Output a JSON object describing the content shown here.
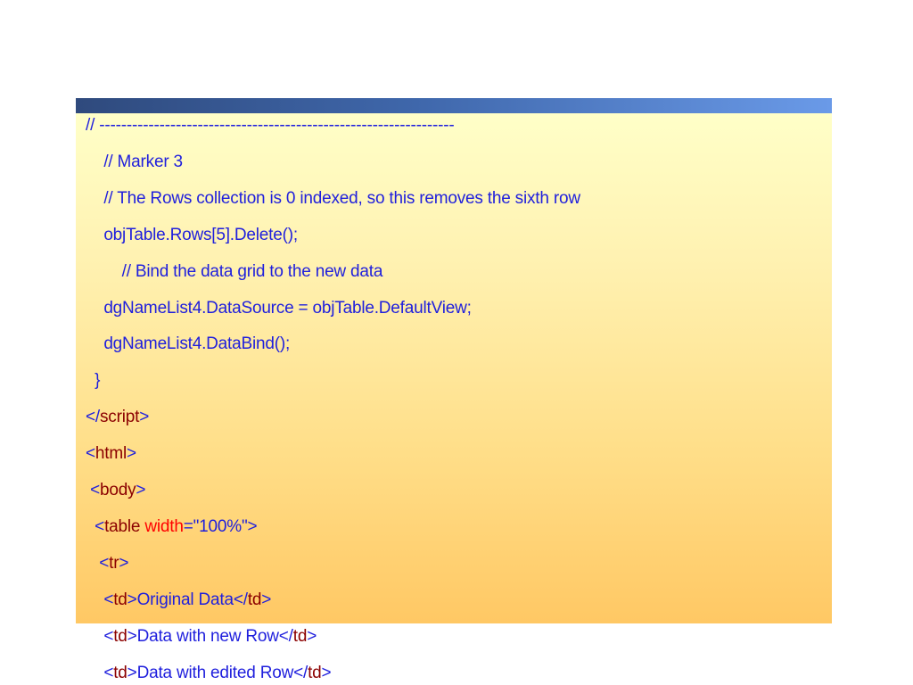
{
  "slide": {
    "code_lines": [
      [
        {
          "text": "// -----------------------------------------------------------------",
          "c": "blue"
        }
      ],
      [
        {
          "text": "    // Marker 3",
          "c": "blue"
        }
      ],
      [
        {
          "text": "    // The Rows collection is 0 indexed, so this removes the sixth row",
          "c": "blue"
        }
      ],
      [
        {
          "text": "    objTable.Rows[5].Delete();",
          "c": "blue"
        }
      ],
      [
        {
          "text": "        // Bind the data grid to the new data",
          "c": "blue"
        }
      ],
      [
        {
          "text": "    dgNameList4.DataSource = objTable.DefaultView;",
          "c": "blue"
        }
      ],
      [
        {
          "text": "    dgNameList4.DataBind();",
          "c": "blue"
        }
      ],
      [
        {
          "text": "  }",
          "c": "blue"
        }
      ],
      [
        {
          "text": "</",
          "c": "blue"
        },
        {
          "text": "script",
          "c": "tag"
        },
        {
          "text": ">",
          "c": "blue"
        }
      ],
      [
        {
          "text": "<",
          "c": "blue"
        },
        {
          "text": "html",
          "c": "tag"
        },
        {
          "text": ">",
          "c": "blue"
        }
      ],
      [
        {
          "text": " <",
          "c": "blue"
        },
        {
          "text": "body",
          "c": "tag"
        },
        {
          "text": ">",
          "c": "blue"
        }
      ],
      [
        {
          "text": "  <",
          "c": "blue"
        },
        {
          "text": "table ",
          "c": "tag"
        },
        {
          "text": "width",
          "c": "attr"
        },
        {
          "text": "=\"100%\">",
          "c": "blue"
        }
      ],
      [
        {
          "text": "   <",
          "c": "blue"
        },
        {
          "text": "tr",
          "c": "tag"
        },
        {
          "text": ">",
          "c": "blue"
        }
      ],
      [
        {
          "text": "    <",
          "c": "blue"
        },
        {
          "text": "td",
          "c": "tag"
        },
        {
          "text": ">Original Data</",
          "c": "blue"
        },
        {
          "text": "td",
          "c": "tag"
        },
        {
          "text": ">",
          "c": "blue"
        }
      ],
      [
        {
          "text": "    <",
          "c": "blue"
        },
        {
          "text": "td",
          "c": "tag"
        },
        {
          "text": ">Data with new Row</",
          "c": "blue"
        },
        {
          "text": "td",
          "c": "tag"
        },
        {
          "text": ">",
          "c": "blue"
        }
      ],
      [
        {
          "text": "    <",
          "c": "blue"
        },
        {
          "text": "td",
          "c": "tag"
        },
        {
          "text": ">Data with edited Row</",
          "c": "blue"
        },
        {
          "text": "td",
          "c": "tag"
        },
        {
          "text": ">",
          "c": "blue"
        }
      ]
    ]
  },
  "colors": {
    "code_text": "#1f1fdd",
    "tag_name": "#8b0000",
    "attribute": "#ff0000",
    "panel_top": "#ffffc8",
    "panel_bottom": "#ffc864",
    "bar_left": "#2f4a7d",
    "bar_right": "#6a9ae8"
  }
}
